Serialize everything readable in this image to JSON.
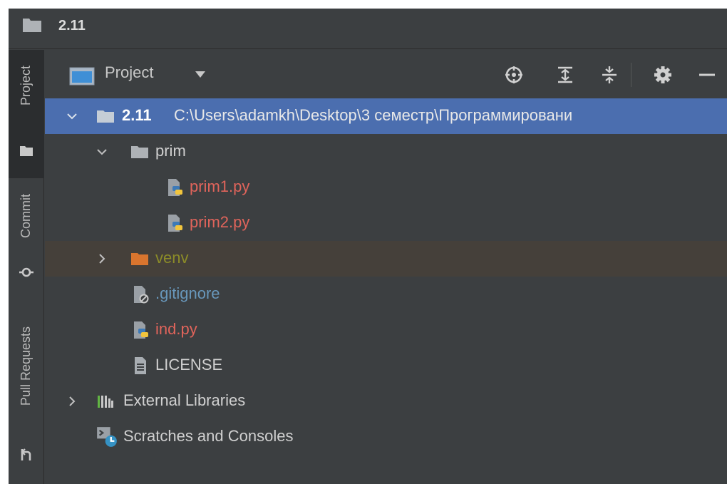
{
  "titlebar": {
    "title": "2.11",
    "icon": "folder-icon"
  },
  "toolstrip": {
    "items": [
      {
        "label": "Project",
        "icon": "folder-icon",
        "active": true
      },
      {
        "label": "Commit",
        "icon": "commit-icon",
        "active": false
      },
      {
        "label": "Pull Requests",
        "icon": "pull-request-icon",
        "active": false
      }
    ]
  },
  "panel": {
    "title": "Project",
    "actions": [
      {
        "name": "locate-icon"
      },
      {
        "name": "expand-all-icon"
      },
      {
        "name": "collapse-all-icon"
      },
      {
        "name": "gear-icon"
      },
      {
        "name": "hide-icon"
      }
    ]
  },
  "tree": {
    "root": {
      "name": "2.11",
      "path": "C:\\Users\\adamkh\\Desktop\\3 семестр\\Программировани"
    },
    "prim": {
      "name": "prim"
    },
    "prim1": {
      "name": "prim1.py"
    },
    "prim2": {
      "name": "prim2.py"
    },
    "venv": {
      "name": "venv"
    },
    "gitignore": {
      "name": ".gitignore"
    },
    "ind": {
      "name": "ind.py"
    },
    "license": {
      "name": "LICENSE"
    },
    "external": {
      "name": "External Libraries"
    },
    "scratches": {
      "name": "Scratches and Consoles"
    }
  },
  "colors": {
    "background": "#3c3f41",
    "selection": "#4b6eaf",
    "excluded_row": "#45403a",
    "modified_file": "#e0645b",
    "ignored_file": "#6897bb",
    "excluded_folder": "#8c8c28"
  }
}
